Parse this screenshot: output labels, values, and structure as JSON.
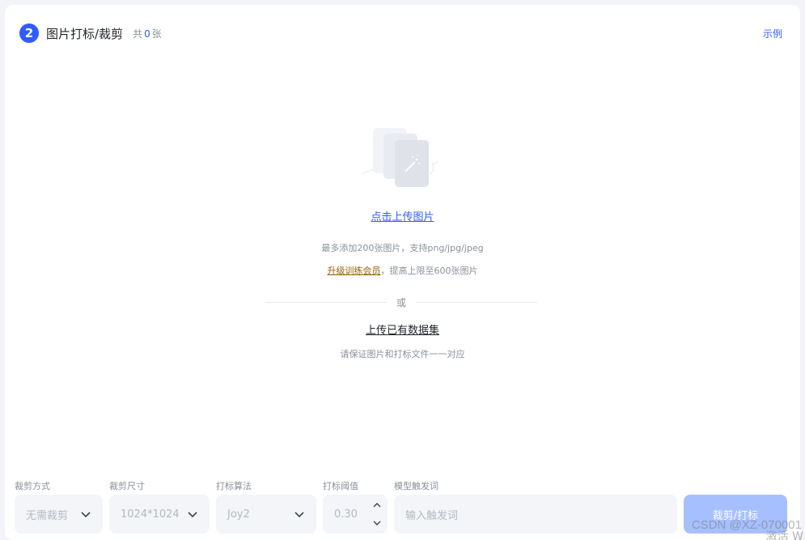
{
  "header": {
    "step_number": "2",
    "title": "图片打标/裁剪",
    "count_prefix": "共",
    "count_value": "0",
    "count_suffix": "张",
    "example_link": "示例"
  },
  "upload": {
    "link": "点击上传图片",
    "limit_text": "最多添加200张图片，支持png/jpg/jpeg",
    "vip_link": "升级训练会员",
    "vip_suffix": "，提高上限至600张图片",
    "or_text": "或",
    "dataset_link": "上传已有数据集",
    "ensure_text": "请保证图片和打标文件一一对应"
  },
  "controls": {
    "crop_method": {
      "label": "裁剪方式",
      "value": "无需裁剪"
    },
    "crop_size": {
      "label": "裁剪尺寸",
      "value": "1024*1024"
    },
    "tag_algo": {
      "label": "打标算法",
      "value": "Joy2"
    },
    "tag_threshold": {
      "label": "打标阈值",
      "value": "0.30"
    },
    "trigger_word": {
      "label": "模型触发词",
      "placeholder": "输入触发词"
    },
    "submit_button": "裁剪/打标"
  },
  "overlay": {
    "watermark": "CSDN @XZ-070001",
    "activate": "激活 W"
  },
  "colors": {
    "accent": "#2f5cff",
    "vip": "#9a5b00",
    "button_disabled": "#a6c0ff"
  }
}
